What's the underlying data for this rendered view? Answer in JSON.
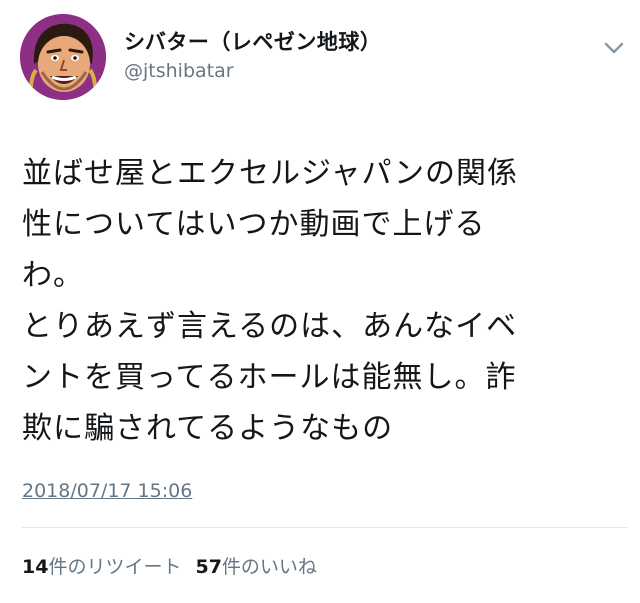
{
  "user": {
    "display_name": "シバター（レペゼン地球）",
    "handle": "@jtshibatar"
  },
  "tweet": {
    "lines": [
      "並ばせ屋とエクセルジャパンの関係",
      "性についてはいつか動画で上げる",
      "わ。",
      "とりあえず言えるのは、あんなイベ",
      "ントを買ってるホールは能無し。詐",
      "欺に騙されてるようなもの"
    ],
    "timestamp": "2018/07/17 15:06"
  },
  "stats": {
    "retweet_count": "14",
    "retweet_label": "件のリツイート",
    "like_count": "57",
    "like_label": "件のいいね"
  },
  "icons": {
    "avatar": "user-avatar",
    "menu": "chevron-down-icon"
  },
  "colors": {
    "text_primary": "#14171a",
    "text_secondary": "#657786",
    "avatar_bg": "#8e2f86",
    "divider": "#e1e8ed"
  }
}
